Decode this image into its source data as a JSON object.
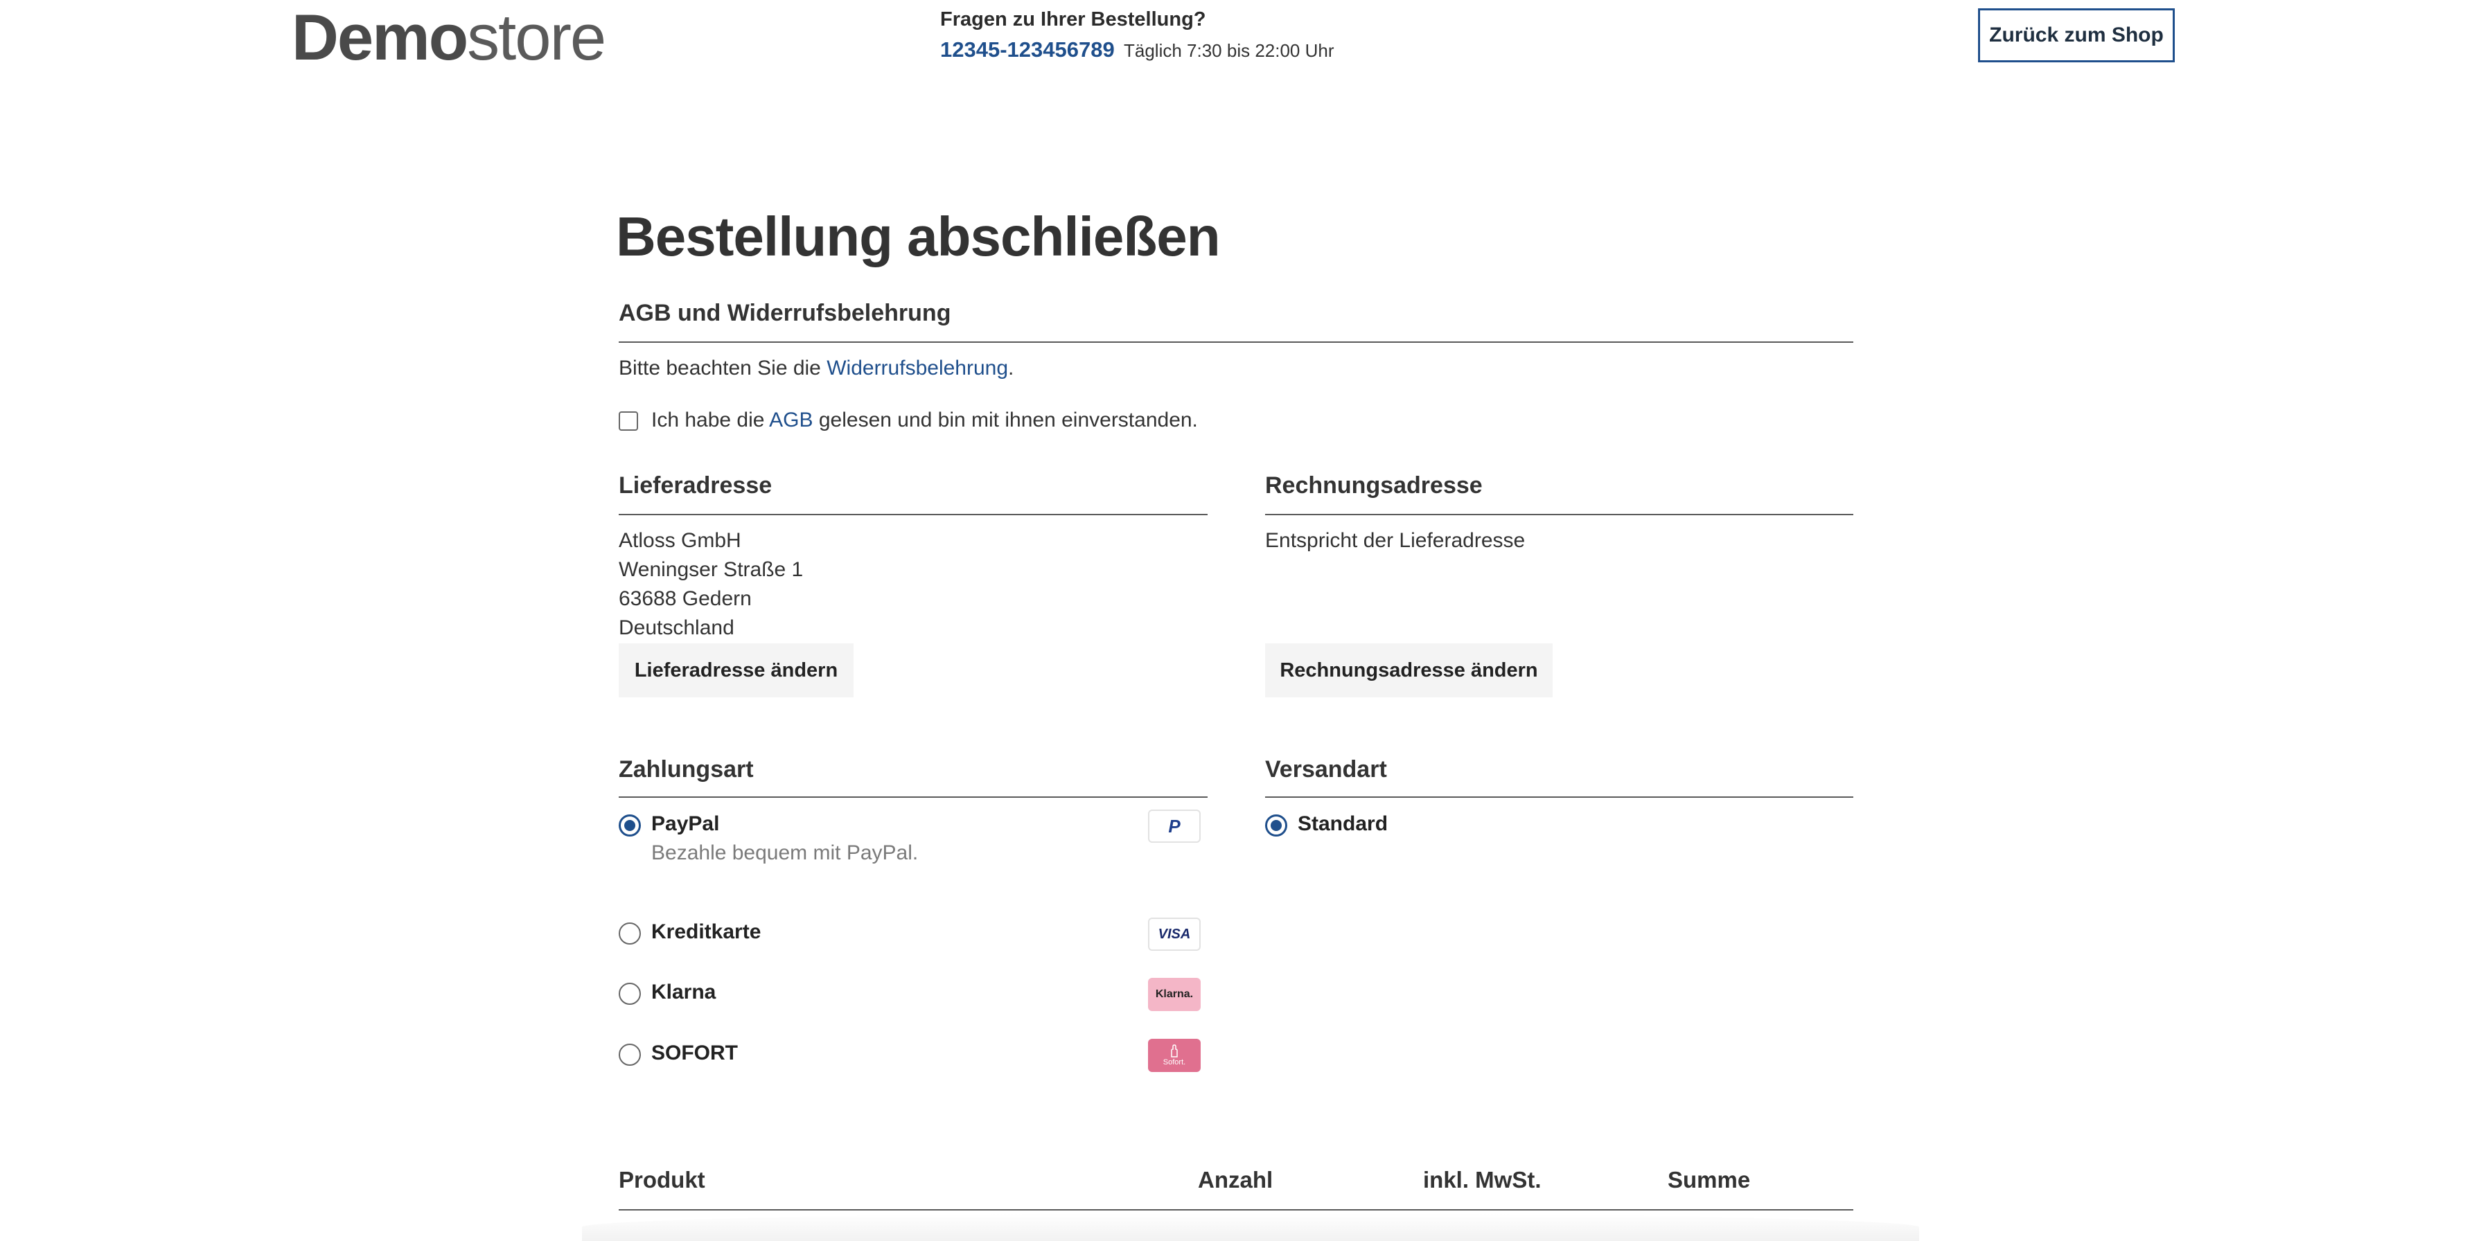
{
  "header": {
    "logo_bold": "Demo",
    "logo_light": "store",
    "question": "Fragen zu Ihrer Bestellung?",
    "phone": "12345-123456789",
    "hours": "Täglich 7:30 bis 22:00 Uhr",
    "back_button": "Zurück zum Shop"
  },
  "page_title": "Bestellung abschließen",
  "terms": {
    "title": "AGB und Widerrufsbelehrung",
    "notice_prefix": "Bitte beachten Sie die ",
    "notice_link": "Widerrufsbelehrung",
    "notice_suffix": ".",
    "checkbox_prefix": "Ich habe die ",
    "checkbox_link": "AGB",
    "checkbox_suffix": " gelesen und bin mit ihnen einverstanden.",
    "checkbox_checked": false
  },
  "shipping_address": {
    "title": "Lieferadresse",
    "lines": [
      "Atloss GmbH",
      "Weningser Straße 1",
      "63688 Gedern",
      "Deutschland"
    ],
    "change_button": "Lieferadresse ändern"
  },
  "billing_address": {
    "title": "Rechnungsadresse",
    "text": "Entspricht der Lieferadresse",
    "change_button": "Rechnungsadresse ändern"
  },
  "payment": {
    "title": "Zahlungsart",
    "options": [
      {
        "label": "PayPal",
        "description": "Bezahle bequem mit PayPal.",
        "selected": true,
        "icon": "paypal-icon",
        "badge_text": "P"
      },
      {
        "label": "Kreditkarte",
        "selected": false,
        "icon": "visa-icon",
        "badge_text": "VISA"
      },
      {
        "label": "Klarna",
        "selected": false,
        "icon": "klarna-icon",
        "badge_text": "Klarna."
      },
      {
        "label": "SOFORT",
        "selected": false,
        "icon": "sofort-icon",
        "badge_text": "Sofort."
      }
    ]
  },
  "shipping_method": {
    "title": "Versandart",
    "options": [
      {
        "label": "Standard",
        "selected": true
      }
    ]
  },
  "product_table": {
    "columns": [
      "Produkt",
      "Anzahl",
      "inkl. MwSt.",
      "Summe"
    ]
  },
  "colors": {
    "accent": "#1f4f8c",
    "text": "#333333",
    "muted": "#7a7a7a",
    "button_bg": "#f4f4f4",
    "klarna_pink": "#f4b6c7",
    "sofort_pink": "#e0708f"
  }
}
